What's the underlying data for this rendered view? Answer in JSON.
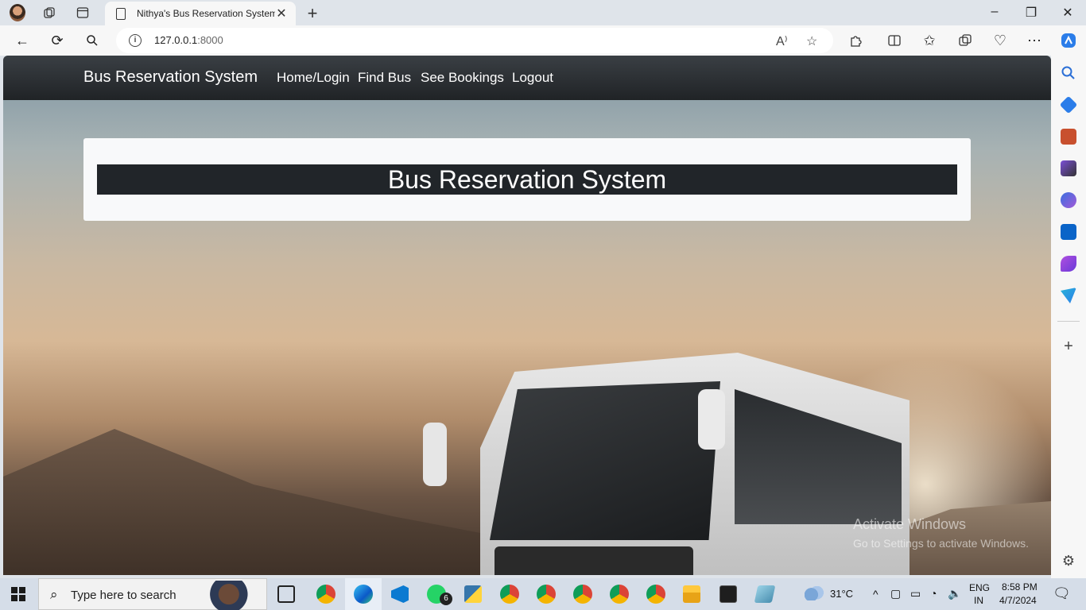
{
  "browser": {
    "tab_title": "Nithya's Bus Reservation System",
    "url_host": "127.0.0.1",
    "url_port": ":8000",
    "new_tab_symbol": "+",
    "tab_close_symbol": "✕"
  },
  "site": {
    "brand": "Bus Reservation System",
    "nav": [
      "Home/Login",
      "Find Bus",
      "See Bookings",
      "Logout"
    ],
    "hero_title": "Bus Reservation System"
  },
  "watermark": {
    "line1": "Activate Windows",
    "line2": "Go to Settings to activate Windows."
  },
  "taskbar": {
    "search_placeholder": "Type here to search",
    "whatsapp_badge": "6",
    "temperature": "31°C",
    "lang_top": "ENG",
    "lang_bottom": "IN",
    "time": "8:58 PM",
    "date": "4/7/2024"
  },
  "colors": {
    "navbar": "#212529",
    "card": "#f8f9fa",
    "banner": "#212529",
    "chrome": "#dfe4ea"
  }
}
